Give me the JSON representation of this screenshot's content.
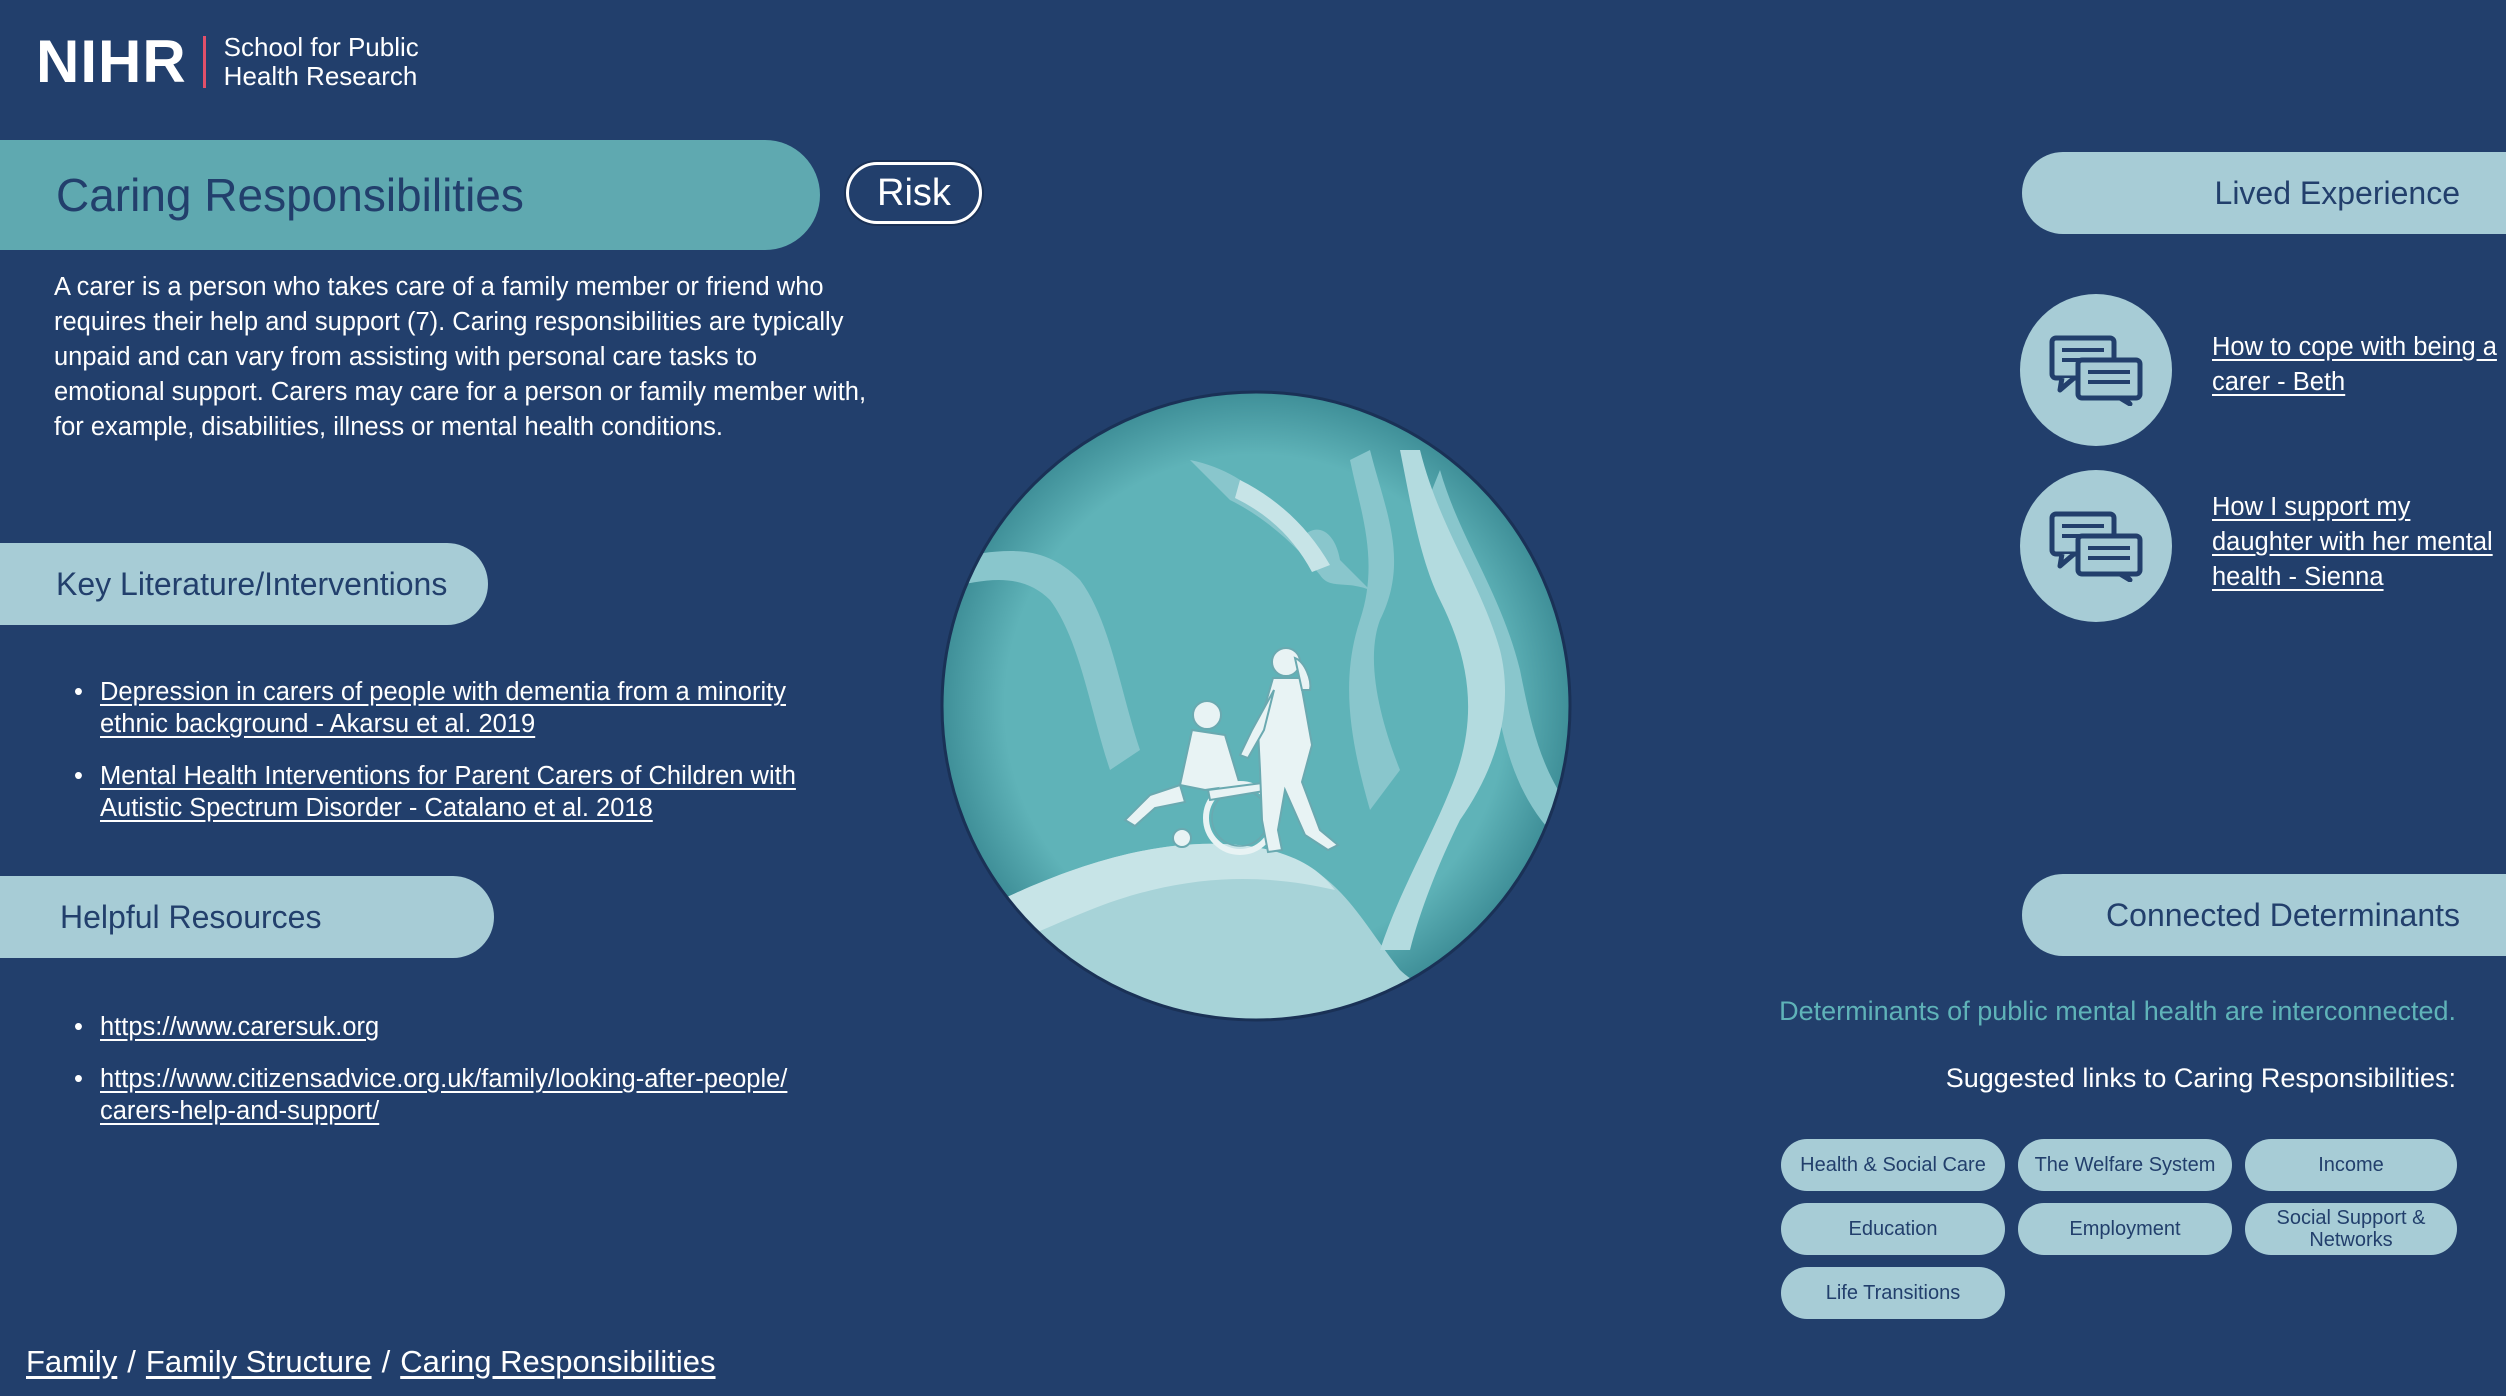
{
  "logo": {
    "brand": "NIHR",
    "school": "School for Public\nHealth Research"
  },
  "colors": {
    "background": "#223f6c",
    "title_bar": "#5fa9b0",
    "pill": "#a7ccd6",
    "divider": "#e2506a",
    "note_text": "#5fb3b8"
  },
  "title": "Caring Responsibilities",
  "risk_button": "Risk",
  "intro": "A carer is a person who takes care of a family member or friend who requires their help and support (7). Caring responsibilities are typically unpaid and can vary from assisting with personal care tasks to emotional support. Carers may care for a person or family member with, for example, disabilities, illness or mental health conditions.",
  "literature": {
    "header": "Key Literature/Interventions",
    "items": [
      "Depression in carers of people with dementia from a minority ethnic background - Akarsu et al. 2019",
      "Mental Health Interventions for Parent Carers of Children with Autistic Spectrum Disorder - Catalano et al. 2018"
    ]
  },
  "resources": {
    "header": "Helpful Resources",
    "items": [
      "https://www.carersuk.org",
      "https://www.citizensadvice.org.uk/family/looking-after-people/carers-help-and-support/"
    ]
  },
  "lived_experience": {
    "header": "Lived Experience",
    "items": [
      {
        "label": "How to cope with being a carer - Beth",
        "icon": "chat-bubbles-icon"
      },
      {
        "label": "How I support my daughter with her mental health - Sienna",
        "icon": "chat-bubbles-icon"
      }
    ]
  },
  "connected": {
    "header": "Connected Determinants",
    "note": "Determinants of public mental health are interconnected.",
    "subheading": "Suggested links to Caring Responsibilities:",
    "tags": [
      "Health & Social Care",
      "The Welfare System",
      "Income",
      "Education",
      "Employment",
      "Social Support & Networks",
      "Life Transitions"
    ]
  },
  "breadcrumb": [
    "Family",
    "Family Structure",
    "Caring Responsibilities"
  ],
  "illustration": {
    "icon": "carer-pushing-wheelchair-illustration"
  }
}
